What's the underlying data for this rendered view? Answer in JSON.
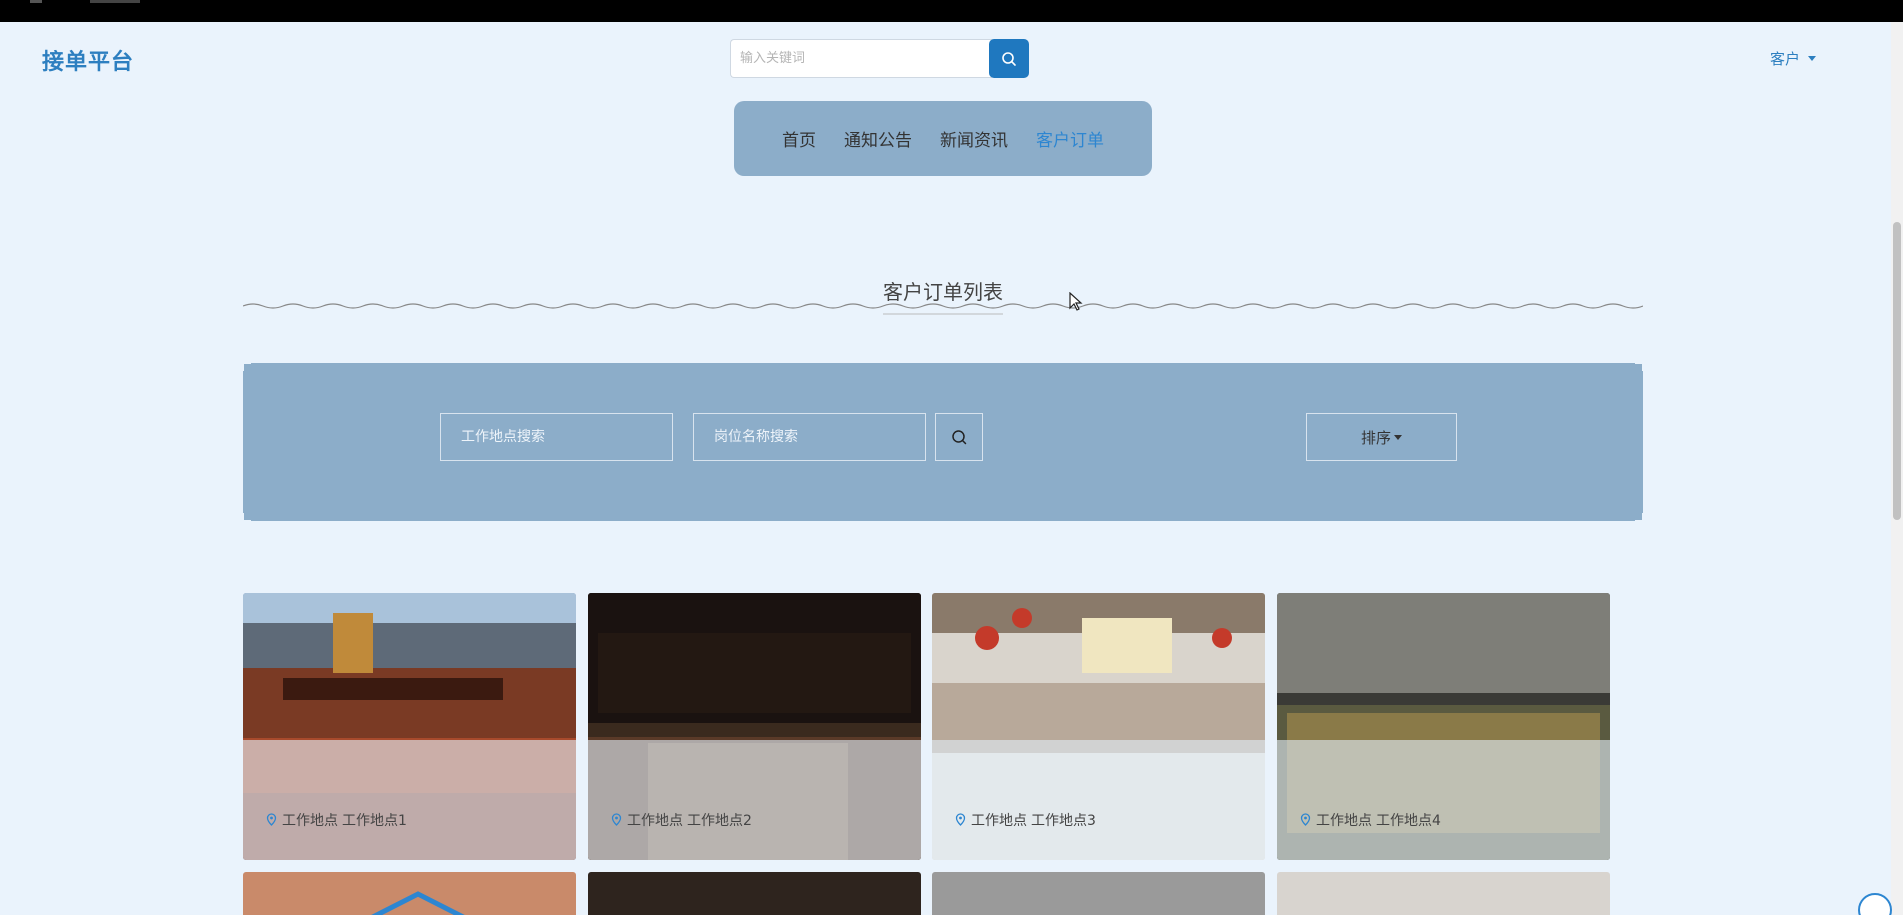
{
  "header": {
    "logo": "接单平台",
    "search_placeholder": "输入关键词",
    "user_menu": "客户"
  },
  "nav": {
    "items": [
      {
        "label": "首页",
        "active": false
      },
      {
        "label": "通知公告",
        "active": false
      },
      {
        "label": "新闻资讯",
        "active": false
      },
      {
        "label": "客户订单",
        "active": true
      }
    ]
  },
  "section": {
    "title": "客户订单列表"
  },
  "filters": {
    "location_placeholder": "工作地点搜索",
    "position_placeholder": "岗位名称搜索",
    "sort_label": "排序"
  },
  "cards": [
    {
      "location_label": "工作地点",
      "location_value": "工作地点1"
    },
    {
      "location_label": "工作地点",
      "location_value": "工作地点2"
    },
    {
      "location_label": "工作地点",
      "location_value": "工作地点3"
    },
    {
      "location_label": "工作地点",
      "location_value": "工作地点4"
    }
  ],
  "colors": {
    "background": "#eaf3fc",
    "brand": "#2d7fc0",
    "panel": "#8cadc9",
    "search_button": "#1f78bf",
    "active_nav": "#2d86d1"
  },
  "icons": [
    "search-icon",
    "location-pin-icon",
    "chat-icon",
    "caret-down-icon"
  ]
}
